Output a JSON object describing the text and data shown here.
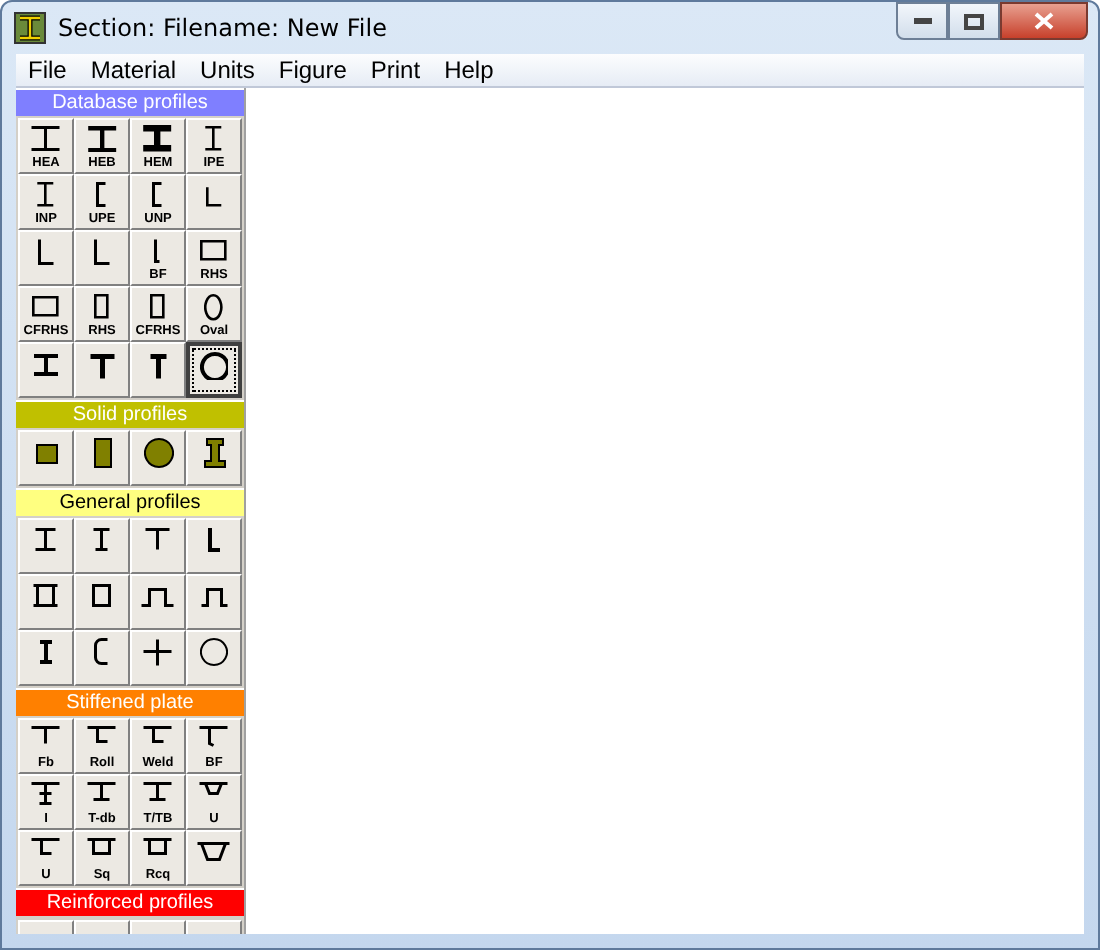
{
  "window": {
    "title": "Section: Filename: New File"
  },
  "menu": [
    "File",
    "Material",
    "Units",
    "Figure",
    "Print",
    "Help"
  ],
  "palette": [
    {
      "header": "Database profiles",
      "color": "#7f7fff",
      "buttons": [
        {
          "label": "HEA",
          "kind": "i-wide",
          "selected": false
        },
        {
          "label": "HEB",
          "kind": "i-thick",
          "selected": false
        },
        {
          "label": "HEM",
          "kind": "i-heavy",
          "selected": false
        },
        {
          "label": "IPE",
          "kind": "i-narrow",
          "selected": false
        },
        {
          "label": "INP",
          "kind": "i-narrow",
          "selected": false
        },
        {
          "label": "UPE",
          "kind": "channel",
          "selected": false
        },
        {
          "label": "UNP",
          "kind": "channel",
          "selected": false
        },
        {
          "kind": "angle-small",
          "selected": false
        },
        {
          "kind": "angle",
          "selected": false
        },
        {
          "kind": "angle",
          "selected": false
        },
        {
          "label": "BF",
          "kind": "bulb",
          "selected": false
        },
        {
          "label": "RHS",
          "kind": "box",
          "selected": false
        },
        {
          "label": "CFRHS",
          "kind": "box",
          "selected": false
        },
        {
          "label": "RHS",
          "kind": "box-tall",
          "selected": false
        },
        {
          "label": "CFRHS",
          "kind": "box-tall",
          "selected": false
        },
        {
          "label": "Oval",
          "kind": "oval",
          "selected": false
        },
        {
          "kind": "i-bold",
          "selected": false
        },
        {
          "kind": "tee",
          "selected": false
        },
        {
          "kind": "tee-small",
          "selected": false
        },
        {
          "kind": "circle",
          "selected": true
        }
      ]
    },
    {
      "header": "Solid profiles",
      "color": "#c0c000",
      "buttons": [
        {
          "kind": "solid-square",
          "selected": false
        },
        {
          "kind": "solid-rect",
          "selected": false
        },
        {
          "kind": "solid-circle",
          "selected": false
        },
        {
          "kind": "rail",
          "selected": false
        }
      ]
    },
    {
      "header": "General profiles",
      "color": "#ffff80",
      "buttons": [
        {
          "kind": "i-general",
          "selected": false
        },
        {
          "kind": "i-general-narrow",
          "selected": false
        },
        {
          "kind": "tee-general",
          "selected": false
        },
        {
          "kind": "angle-bold",
          "selected": false
        },
        {
          "kind": "box-double",
          "selected": false
        },
        {
          "kind": "box-small",
          "selected": false
        },
        {
          "kind": "hat",
          "selected": false
        },
        {
          "kind": "hat-small",
          "selected": false
        },
        {
          "kind": "i-short",
          "selected": false
        },
        {
          "kind": "channel-round",
          "selected": false
        },
        {
          "kind": "cross",
          "selected": false
        },
        {
          "kind": "circle-thin",
          "selected": false
        }
      ]
    },
    {
      "header": "Stiffened plate",
      "color": "#ff8000",
      "buttons": [
        {
          "label": "Fb",
          "kind": "plate-flat",
          "selected": false
        },
        {
          "label": "Roll",
          "kind": "plate-angle",
          "selected": false
        },
        {
          "label": "Weld",
          "kind": "plate-angle",
          "selected": false
        },
        {
          "label": "BF",
          "kind": "plate-bulb",
          "selected": false
        },
        {
          "label": "I",
          "kind": "plate-i",
          "selected": false
        },
        {
          "label": "T-db",
          "kind": "plate-tee",
          "selected": false
        },
        {
          "label": "T/TB",
          "kind": "plate-tee",
          "selected": false
        },
        {
          "label": "U",
          "kind": "plate-u",
          "selected": false
        },
        {
          "label": "U",
          "kind": "plate-angle",
          "selected": false
        },
        {
          "label": "Sq",
          "kind": "plate-box",
          "selected": false
        },
        {
          "label": "Rcq",
          "kind": "plate-box",
          "selected": false
        },
        {
          "kind": "plate-trap",
          "selected": false
        }
      ]
    },
    {
      "header": "Reinforced profiles",
      "color": "#ff0000"
    }
  ]
}
